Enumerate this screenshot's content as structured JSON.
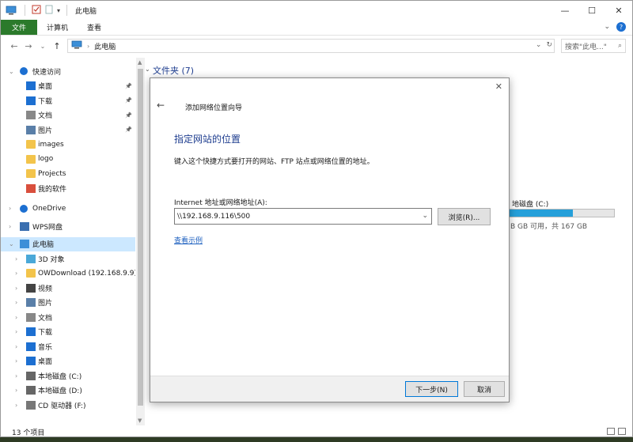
{
  "window": {
    "title": "此电脑"
  },
  "ribbon": {
    "tabs": [
      "文件",
      "计算机",
      "查看"
    ]
  },
  "address": {
    "path": "此电脑",
    "search_placeholder": "搜索\"此电...\""
  },
  "sidebar": {
    "items": [
      {
        "label": "快速访问",
        "icon": "star-icon"
      },
      {
        "label": "桌面",
        "icon": "desktop-icon",
        "pinned": true
      },
      {
        "label": "下载",
        "icon": "download-icon",
        "pinned": true
      },
      {
        "label": "文档",
        "icon": "document-icon",
        "pinned": true
      },
      {
        "label": "图片",
        "icon": "picture-icon",
        "pinned": true
      },
      {
        "label": "images",
        "icon": "folder-icon"
      },
      {
        "label": "logo",
        "icon": "folder-icon"
      },
      {
        "label": "Projects",
        "icon": "folder-icon"
      },
      {
        "label": "我的软件",
        "icon": "app-folder-icon"
      },
      {
        "label": "OneDrive",
        "icon": "cloud-icon"
      },
      {
        "label": "WPS网盘",
        "icon": "wps-cloud-icon"
      },
      {
        "label": "此电脑",
        "icon": "computer-icon"
      },
      {
        "label": "3D 对象",
        "icon": "cube-icon"
      },
      {
        "label": "OWDownload (192.168.9.9)",
        "icon": "network-drive-icon"
      },
      {
        "label": "视频",
        "icon": "video-icon"
      },
      {
        "label": "图片",
        "icon": "picture-icon"
      },
      {
        "label": "文档",
        "icon": "document-icon"
      },
      {
        "label": "下载",
        "icon": "download-icon"
      },
      {
        "label": "音乐",
        "icon": "music-icon"
      },
      {
        "label": "桌面",
        "icon": "desktop-icon"
      },
      {
        "label": "本地磁盘 (C:)",
        "icon": "drive-icon"
      },
      {
        "label": "本地磁盘 (D:)",
        "icon": "drive-icon"
      },
      {
        "label": "CD 驱动器 (F:)",
        "icon": "cd-icon"
      }
    ]
  },
  "content": {
    "group_title": "文件夹 (7)",
    "drive_label": "地磁盘 (C:)",
    "drive_free": "B GB 可用，共 167 GB",
    "drive_used_fraction": 0.62
  },
  "status": {
    "count": "13 个项目"
  },
  "dialog": {
    "title": "添加网络位置向导",
    "heading": "指定网站的位置",
    "description": "键入这个快捷方式要打开的网站、FTP 站点或网络位置的地址。",
    "field_label": "Internet 地址或网络地址(A):",
    "field_value": "\\\\192.168.9.116\\500",
    "browse_label": "浏览(R)...",
    "example_link": "查看示例",
    "next_label": "下一步(N)",
    "cancel_label": "取消"
  },
  "colors": {
    "accent_green": "#2b7a2b",
    "heading_blue": "#1e3d8f",
    "selection": "#cce8ff",
    "drive_fill": "#26a0da"
  }
}
